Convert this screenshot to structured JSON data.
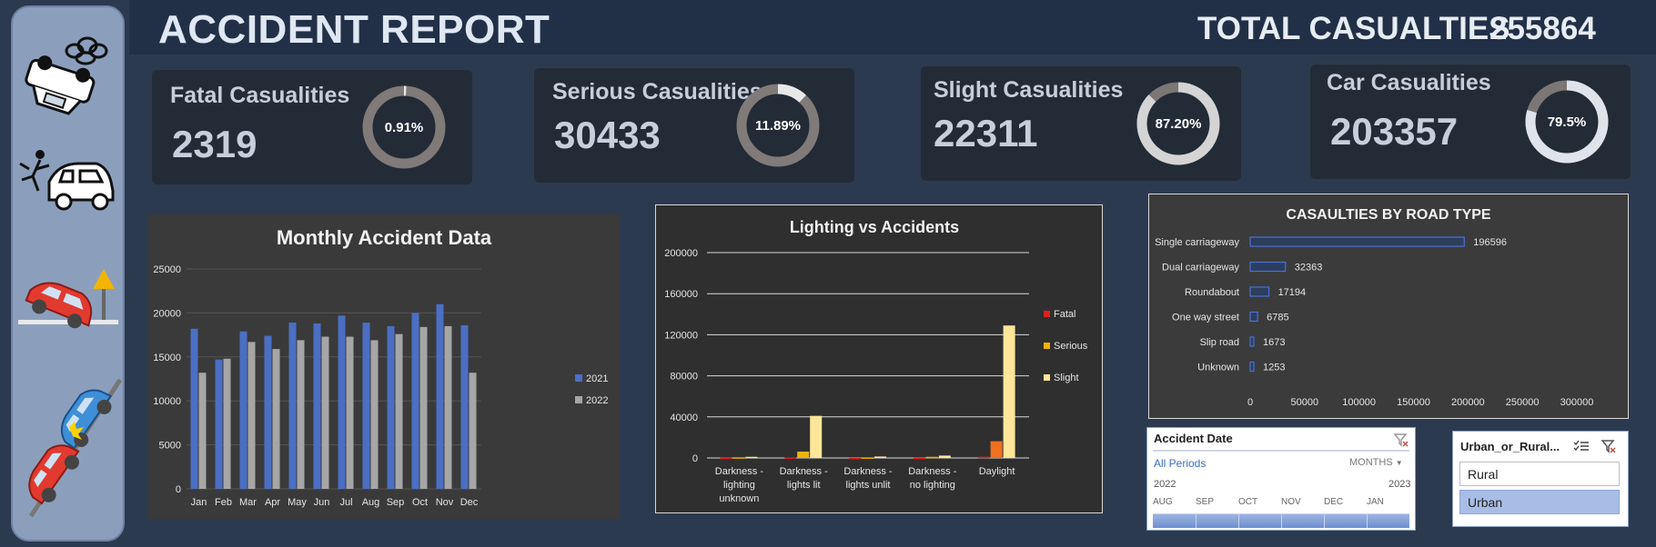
{
  "header": {
    "title": "ACCIDENT REPORT",
    "total_label": "TOTAL CASUALTIES",
    "total_value": "255864"
  },
  "kpis": [
    {
      "label": "Fatal Casualities",
      "value": "2319",
      "percent": "0.91%",
      "fraction": 0.0091,
      "ring": "#e8e8e8",
      "track": "#807a78"
    },
    {
      "label": "Serious Casualities",
      "value": "30433",
      "percent": "11.89%",
      "fraction": 0.1189,
      "ring": "#e8e8e8",
      "track": "#807a78"
    },
    {
      "label": "Slight Casualities",
      "value": "22311",
      "percent": "87.20%",
      "fraction": 0.872,
      "ring": "#d4d4d4",
      "track": "#7c7775"
    },
    {
      "label": "Car Casualities",
      "value": "203357",
      "percent": "79.5%",
      "fraction": 0.795,
      "ring": "#dfe3ea",
      "track": "#7c7775"
    }
  ],
  "chart_data": [
    {
      "type": "bar",
      "title": "Monthly Accident Data",
      "categories": [
        "Jan",
        "Feb",
        "Mar",
        "Apr",
        "May",
        "Jun",
        "Jul",
        "Aug",
        "Sep",
        "Oct",
        "Nov",
        "Dec"
      ],
      "series": [
        {
          "name": "2021",
          "color": "#4a6fc4",
          "values": [
            18200,
            14700,
            17900,
            17400,
            18900,
            18800,
            19700,
            18900,
            18500,
            20000,
            21000,
            18600
          ]
        },
        {
          "name": "2022",
          "color": "#a6a6a6",
          "values": [
            13200,
            14800,
            16700,
            15900,
            16900,
            17300,
            17300,
            16900,
            17600,
            18400,
            18500,
            13200
          ]
        }
      ],
      "ylim": [
        0,
        25000
      ],
      "yticks": [
        0,
        5000,
        10000,
        15000,
        20000,
        25000
      ],
      "legend": "right",
      "grid": true
    },
    {
      "type": "bar",
      "title": "Lighting vs Accidents",
      "categories": [
        "Darkness - lighting unknown",
        "Darkness - lights lit",
        "Darkness - lights unlit",
        "Darkness - no lighting",
        "Daylight"
      ],
      "series": [
        {
          "name": "Fatal",
          "color": "#e02020",
          "values": [
            300,
            500,
            100,
            200,
            1200
          ]
        },
        {
          "name": "Serious",
          "color": "#f0b400",
          "values": [
            600,
            6200,
            500,
            1100,
            16300
          ]
        },
        {
          "name": "Slight",
          "color": "#ffe699",
          "values": [
            1100,
            41000,
            1400,
            2300,
            129000
          ]
        }
      ],
      "series_colors_override": {
        "Daylight.Serious": "#f07020"
      },
      "ylim": [
        0,
        200000
      ],
      "yticks": [
        0,
        40000,
        80000,
        120000,
        160000,
        200000
      ],
      "legend": "right",
      "grid": true
    },
    {
      "type": "bar",
      "orientation": "horizontal",
      "title": "CASAULTIES BY ROAD TYPE",
      "categories": [
        "Single carriageway",
        "Dual carriageway",
        "Roundabout",
        "One way street",
        "Slip road",
        "Unknown"
      ],
      "values": [
        196596,
        32363,
        17194,
        6785,
        1673,
        1253
      ],
      "xlim": [
        0,
        300000
      ],
      "xticks": [
        0,
        50000,
        100000,
        150000,
        200000,
        250000,
        300000
      ],
      "grid": false
    }
  ],
  "slicer_date": {
    "title": "Accident Date",
    "all_periods": "All Periods",
    "unit": "MONTHS",
    "year_left": "2022",
    "year_right": "2023",
    "months": [
      "AUG",
      "SEP",
      "OCT",
      "NOV",
      "DEC",
      "JAN"
    ]
  },
  "slicer_area": {
    "title": "Urban_or_Rural...",
    "items": [
      "Rural",
      "Urban"
    ],
    "selected": "Urban"
  },
  "icons": [
    "overturned-car-icon",
    "pedestrian-hit-car-icon",
    "car-crash-sign-icon",
    "car-collision-icon",
    "clear-filter-icon",
    "multi-select-icon"
  ]
}
